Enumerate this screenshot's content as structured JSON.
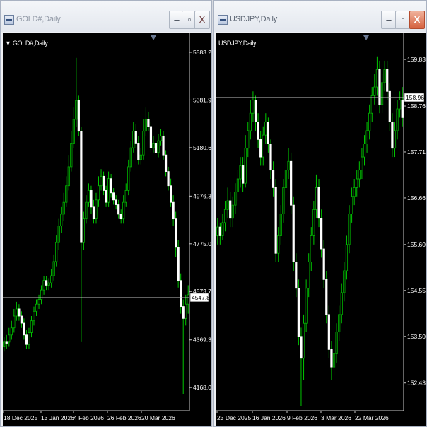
{
  "windows": [
    {
      "id": "gold",
      "title": "GOLD#,Daily",
      "chart_label": "GOLD#,Daily",
      "show_arrow": true,
      "buttons": {
        "minimize": "–",
        "restore": "▫",
        "close": "X"
      },
      "close_active": false
    },
    {
      "id": "usd",
      "title": "USDJPY,Daily",
      "chart_label": "USDJPY,Daily",
      "show_arrow": false,
      "buttons": {
        "minimize": "–",
        "restore": "▫",
        "close": "X"
      },
      "close_active": true
    }
  ],
  "colors": {
    "background": "#000000",
    "candle_up": "#00b400",
    "candle_down": "#ffffff",
    "wick": "#00c800",
    "axis_text": "#ffffff",
    "price_line": "#c0c0c0",
    "accent_close": "#d5613f"
  },
  "chart_data": [
    {
      "type": "candlestick",
      "title": "GOLD#,Daily",
      "y_ticks": [
        "5583.25",
        "5381.95",
        "5180.65",
        "4976.30",
        "4775.00",
        "4573.70",
        "4369.35",
        "4168.05"
      ],
      "y_tick_values": [
        5583.25,
        5381.95,
        5180.65,
        4976.3,
        4775.0,
        4573.7,
        4369.35,
        4168.05
      ],
      "x_ticks": [
        "18 Dec 2025",
        "13 Jan 2026",
        "4 Feb 2026",
        "26 Feb 2026",
        "20 Mar 2026"
      ],
      "current_price": "4547.88",
      "current_price_value": 4547.88,
      "ylim": [
        4070,
        5640
      ],
      "closes": [
        4360,
        4355,
        4390,
        4420,
        4470,
        4500,
        4470,
        4440,
        4390,
        4350,
        4400,
        4450,
        4490,
        4520,
        4540,
        4580,
        4620,
        4600,
        4610,
        4640,
        4700,
        4780,
        4850,
        4900,
        4950,
        5020,
        5100,
        5200,
        5300,
        5380,
        5250,
        4780,
        4880,
        4950,
        5000,
        4930,
        4880,
        4960,
        5020,
        5060,
        5000,
        4950,
        5050,
        4990,
        4960,
        4940,
        4900,
        4880,
        4950,
        5000,
        5100,
        5180,
        5250,
        5200,
        5130,
        5150,
        5250,
        5300,
        5270,
        5180,
        5200,
        5160,
        5210,
        5230,
        5150,
        5080,
        5020,
        4950,
        4880,
        4760,
        4620,
        4510,
        4460,
        4520,
        4560
      ],
      "opens": [
        4340,
        4360,
        4360,
        4390,
        4420,
        4470,
        4500,
        4470,
        4440,
        4390,
        4350,
        4400,
        4450,
        4490,
        4520,
        4540,
        4580,
        4620,
        4600,
        4610,
        4640,
        4700,
        4780,
        4850,
        4900,
        4950,
        5020,
        5100,
        5200,
        5300,
        5380,
        5250,
        4780,
        4880,
        4950,
        5000,
        4930,
        4880,
        4960,
        5020,
        5060,
        5000,
        4950,
        5050,
        4990,
        4960,
        4940,
        4900,
        4880,
        4950,
        5000,
        5100,
        5180,
        5250,
        5200,
        5130,
        5150,
        5250,
        5300,
        5270,
        5180,
        5200,
        5160,
        5210,
        5230,
        5150,
        5080,
        5020,
        4950,
        4880,
        4760,
        4620,
        4510,
        4460,
        4520
      ],
      "highs": [
        4380,
        4390,
        4420,
        4450,
        4500,
        4530,
        4520,
        4490,
        4460,
        4410,
        4420,
        4470,
        4510,
        4540,
        4560,
        4600,
        4640,
        4640,
        4630,
        4670,
        4730,
        4810,
        4880,
        4930,
        4990,
        5060,
        5150,
        5250,
        5350,
        5560,
        5400,
        5270,
        4910,
        4980,
        5030,
        5020,
        4960,
        4990,
        5060,
        5090,
        5080,
        5020,
        5080,
        5070,
        5010,
        4980,
        4960,
        4920,
        4980,
        5030,
        5130,
        5210,
        5290,
        5280,
        5230,
        5180,
        5300,
        5350,
        5330,
        5290,
        5230,
        5230,
        5240,
        5260,
        5250,
        5170,
        5100,
        5050,
        4980,
        4910,
        4790,
        4650,
        4540,
        4560,
        4600
      ],
      "lows": [
        4320,
        4330,
        4340,
        4370,
        4400,
        4450,
        4450,
        4420,
        4370,
        4330,
        4330,
        4380,
        4430,
        4470,
        4500,
        4520,
        4560,
        4580,
        4580,
        4590,
        4620,
        4680,
        4750,
        4820,
        4870,
        4930,
        5000,
        5080,
        5180,
        5270,
        5230,
        4360,
        4750,
        4860,
        4930,
        4900,
        4860,
        4860,
        4930,
        5000,
        4980,
        4930,
        4930,
        4970,
        4940,
        4920,
        4880,
        4860,
        4860,
        4930,
        4980,
        5080,
        5160,
        5180,
        5110,
        5110,
        5130,
        5230,
        5250,
        5160,
        5160,
        5140,
        5140,
        5190,
        5130,
        5060,
        5000,
        4930,
        4850,
        4720,
        4590,
        4480,
        4140,
        4430,
        4480
      ]
    },
    {
      "type": "candlestick",
      "title": "USDJPY,Daily",
      "y_ticks": [
        "159.830",
        "158.765",
        "157.715",
        "156.665",
        "155.600",
        "154.550",
        "153.500",
        "152.435"
      ],
      "y_tick_values": [
        159.83,
        158.765,
        157.715,
        156.665,
        155.6,
        154.55,
        153.5,
        152.435
      ],
      "x_ticks": [
        "23 Dec 2025",
        "16 Jan 2026",
        "9 Feb 2026",
        "3 Mar 2026",
        "22 Mar 2026"
      ],
      "current_price": "158.960",
      "current_price_value": 158.96,
      "ylim": [
        151.8,
        160.3
      ],
      "closes": [
        156.0,
        155.8,
        156.1,
        156.4,
        156.6,
        156.2,
        156.5,
        156.8,
        157.1,
        157.4,
        157.0,
        157.8,
        158.2,
        158.6,
        158.9,
        158.4,
        158.0,
        157.6,
        158.1,
        158.4,
        157.9,
        157.3,
        156.9,
        155.4,
        155.8,
        156.3,
        156.9,
        157.3,
        157.5,
        156.5,
        155.2,
        154.6,
        153.5,
        153.0,
        153.8,
        154.6,
        155.2,
        155.8,
        156.4,
        156.9,
        156.2,
        155.5,
        154.8,
        154.0,
        153.2,
        152.8,
        153.1,
        153.6,
        154.0,
        154.5,
        155.0,
        155.6,
        156.3,
        156.7,
        156.9,
        157.1,
        157.3,
        157.6,
        157.9,
        158.2,
        158.6,
        159.0,
        159.2,
        159.6,
        158.8,
        159.3,
        159.6,
        159.1,
        158.4,
        157.8,
        158.2,
        158.7,
        158.9,
        158.5
      ],
      "opens": [
        155.8,
        156.0,
        155.8,
        156.1,
        156.4,
        156.6,
        156.2,
        156.5,
        156.8,
        157.1,
        157.4,
        157.0,
        157.8,
        158.2,
        158.6,
        158.9,
        158.4,
        158.0,
        157.6,
        158.1,
        158.4,
        157.9,
        157.3,
        156.9,
        155.4,
        155.8,
        156.3,
        156.9,
        157.3,
        157.5,
        156.5,
        155.2,
        154.6,
        153.5,
        153.0,
        153.8,
        154.6,
        155.2,
        155.8,
        156.4,
        156.9,
        156.2,
        155.5,
        154.8,
        154.0,
        153.2,
        152.8,
        153.1,
        153.6,
        154.0,
        154.5,
        155.0,
        155.6,
        156.3,
        156.7,
        156.9,
        157.1,
        157.3,
        157.6,
        157.9,
        158.2,
        158.6,
        159.0,
        159.2,
        159.6,
        158.8,
        159.3,
        159.6,
        159.1,
        158.4,
        157.8,
        158.2,
        158.7,
        158.9
      ],
      "highs": [
        156.2,
        156.1,
        156.3,
        156.6,
        156.9,
        156.8,
        156.7,
        157.0,
        157.3,
        157.6,
        157.6,
        158.1,
        158.4,
        158.9,
        159.1,
        159.0,
        158.6,
        158.2,
        158.3,
        158.6,
        158.5,
        158.0,
        157.5,
        157.1,
        156.0,
        156.5,
        157.1,
        157.5,
        157.8,
        157.7,
        156.7,
        155.4,
        154.8,
        153.7,
        154.0,
        154.8,
        155.4,
        156.0,
        156.6,
        157.2,
        157.1,
        156.4,
        155.7,
        155.0,
        154.2,
        153.4,
        153.3,
        153.8,
        154.2,
        154.7,
        155.2,
        155.8,
        156.5,
        156.9,
        157.1,
        157.3,
        157.5,
        157.8,
        158.1,
        158.4,
        158.8,
        159.2,
        159.5,
        159.9,
        159.8,
        159.5,
        159.8,
        159.8,
        159.3,
        158.6,
        158.4,
        158.9,
        159.1,
        159.2
      ],
      "lows": [
        155.6,
        155.6,
        155.7,
        155.9,
        156.2,
        156.0,
        156.0,
        156.3,
        156.6,
        156.9,
        156.8,
        156.9,
        157.6,
        158.0,
        158.4,
        158.2,
        157.8,
        157.4,
        157.4,
        157.9,
        157.7,
        157.1,
        156.7,
        155.2,
        155.2,
        155.6,
        156.1,
        156.7,
        157.1,
        156.3,
        155.0,
        154.4,
        153.3,
        151.9,
        152.5,
        153.6,
        154.4,
        155.0,
        155.6,
        156.2,
        156.0,
        155.3,
        154.6,
        153.8,
        153.0,
        152.5,
        152.6,
        152.9,
        153.4,
        153.8,
        154.3,
        154.8,
        155.4,
        156.1,
        156.5,
        156.7,
        156.9,
        157.1,
        157.4,
        157.7,
        158.0,
        158.4,
        158.8,
        159.0,
        158.6,
        158.6,
        159.1,
        158.9,
        158.2,
        157.6,
        157.6,
        158.0,
        158.5,
        158.3
      ]
    }
  ]
}
